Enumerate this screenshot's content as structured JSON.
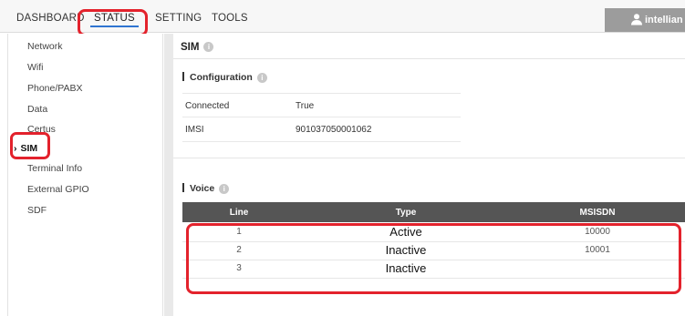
{
  "nav": {
    "tabs": [
      {
        "label": "DASHBOARD"
      },
      {
        "label": "STATUS"
      },
      {
        "label": "SETTING"
      },
      {
        "label": "TOOLS"
      }
    ],
    "user": "intellian"
  },
  "sidebar": {
    "items": [
      {
        "label": "Network"
      },
      {
        "label": "Wifi"
      },
      {
        "label": "Phone/PABX"
      },
      {
        "label": "Data"
      },
      {
        "label": "Certus"
      },
      {
        "label": "SIM",
        "active": true
      },
      {
        "label": "Terminal Info"
      },
      {
        "label": "External GPIO"
      },
      {
        "label": "SDF"
      }
    ]
  },
  "main": {
    "title": "SIM",
    "configuration": {
      "title": "Configuration",
      "rows": [
        {
          "key": "Connected",
          "value": "True"
        },
        {
          "key": "IMSI",
          "value": "901037050001062"
        }
      ]
    },
    "voice": {
      "title": "Voice",
      "headers": {
        "line": "Line",
        "type": "Type",
        "msisdn": "MSISDN"
      },
      "rows": [
        {
          "line": "1",
          "type": "Active",
          "msisdn": "10000"
        },
        {
          "line": "2",
          "type": "Inactive",
          "msisdn": "10001"
        },
        {
          "line": "3",
          "type": "Inactive",
          "msisdn": ""
        }
      ]
    }
  },
  "colors": {
    "highlight": "#e3222c",
    "tab_underline": "#2f75d1",
    "table_header": "#555555"
  }
}
